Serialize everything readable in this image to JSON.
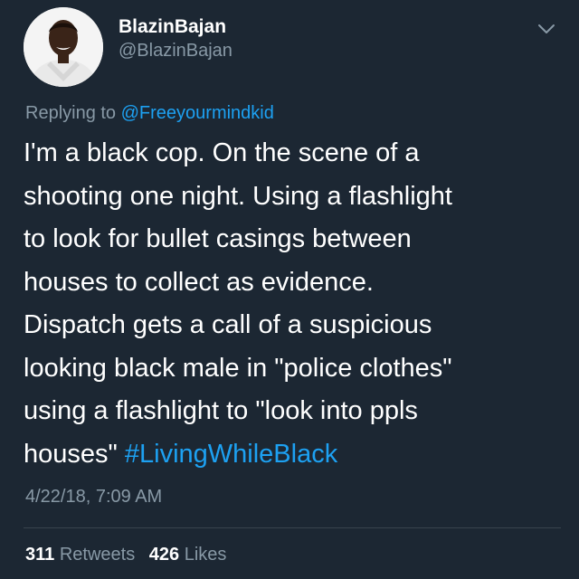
{
  "tweet": {
    "display_name": "BlazinBajan",
    "handle": "@BlazinBajan",
    "reply_prefix": "Replying to",
    "reply_to": "@Freeyourmindkid",
    "body_lines": [
      "I'm a black cop. On the scene of a",
      "shooting one night. Using a flashlight",
      "to look for bullet casings between",
      "houses to collect as evidence.",
      "Dispatch gets a call of a suspicious",
      "looking black male in \"police clothes\"",
      "using a flashlight to \"look into ppls"
    ],
    "last_line_text": "houses\"",
    "hashtag": "#LivingWhileBlack",
    "timestamp": "4/22/18, 7:09 AM",
    "retweets_count": "311",
    "retweets_label": "Retweets",
    "likes_count": "426",
    "likes_label": "Likes"
  },
  "colors": {
    "background": "#1c2733",
    "text_primary": "#ffffff",
    "text_secondary": "#8899a6",
    "link": "#1da1f2",
    "divider": "#38444d"
  },
  "icons": {
    "menu": "chevron-down-icon",
    "avatar": "user-avatar"
  }
}
